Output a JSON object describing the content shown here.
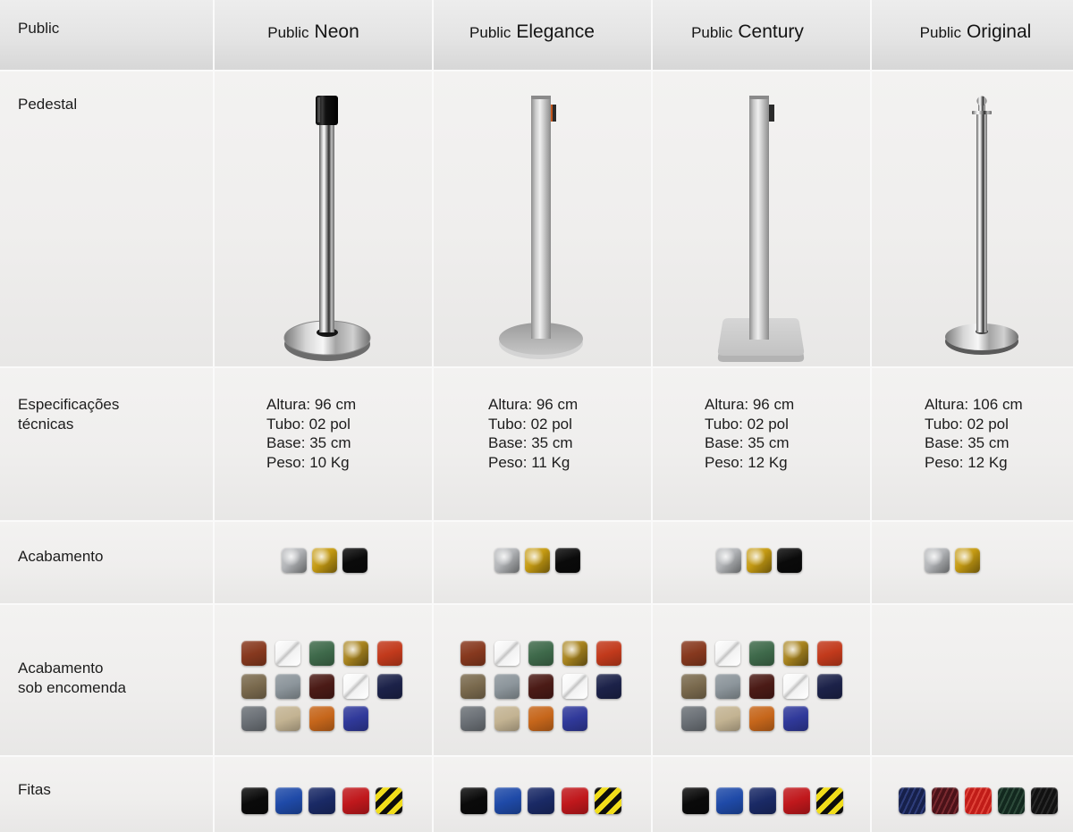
{
  "header": {
    "label": "Public",
    "products": [
      {
        "prefix": "Public",
        "name": "Neon"
      },
      {
        "prefix": "Public",
        "name": "Elegance"
      },
      {
        "prefix": "Public",
        "name": "Century"
      },
      {
        "prefix": "Public",
        "name": "Original"
      }
    ]
  },
  "pedestal": {
    "label": "Pedestal"
  },
  "specs": {
    "label_lines": [
      "Especificações",
      "técnicas"
    ],
    "products": [
      [
        "Altura: 96 cm",
        "Tubo: 02 pol",
        "Base: 35 cm",
        "Peso: 10 Kg"
      ],
      [
        "Altura: 96 cm",
        "Tubo: 02 pol",
        "Base: 35 cm",
        "Peso: 11 Kg"
      ],
      [
        "Altura: 96 cm",
        "Tubo: 02 pol",
        "Base: 35 cm",
        "Peso: 12 Kg"
      ],
      [
        "Altura: 106 cm",
        "Tubo: 02 pol",
        "Base: 35 cm",
        "Peso: 12 Kg"
      ]
    ]
  },
  "finish": {
    "label": "Acabamento",
    "products": [
      [
        {
          "finish": "metallic",
          "color": "#b3b5b8"
        },
        {
          "finish": "metallic",
          "color": "#c49a12"
        },
        {
          "finish": "solid",
          "color": "#0a0a0a"
        }
      ],
      [
        {
          "finish": "metallic",
          "color": "#b3b5b8"
        },
        {
          "finish": "metallic",
          "color": "#c49a12"
        },
        {
          "finish": "solid",
          "color": "#0a0a0a"
        }
      ],
      [
        {
          "finish": "metallic",
          "color": "#b3b5b8"
        },
        {
          "finish": "metallic",
          "color": "#c49a12"
        },
        {
          "finish": "solid",
          "color": "#0a0a0a"
        }
      ],
      [
        {
          "finish": "metallic",
          "color": "#b3b5b8"
        },
        {
          "finish": "metallic",
          "color": "#c49a12"
        }
      ]
    ]
  },
  "custom_finish": {
    "label_lines": [
      "Acabamento",
      "sob encomenda"
    ],
    "products": [
      [
        {
          "finish": "solid",
          "color": "#87391f"
        },
        {
          "finish": "pearl",
          "color": "#f4f4f4"
        },
        {
          "finish": "solid",
          "color": "#3f6a4b"
        },
        {
          "finish": "metallic",
          "color": "#a8841f"
        },
        {
          "finish": "solid",
          "color": "#c23a1c"
        },
        {
          "finish": "solid",
          "color": "#7a6a4e"
        },
        {
          "finish": "solid",
          "color": "#8c959b"
        },
        {
          "finish": "solid",
          "color": "#4b1b16"
        },
        {
          "finish": "pearl",
          "color": "#f7f7f7"
        },
        {
          "finish": "solid",
          "color": "#1c2249"
        },
        {
          "finish": "solid",
          "color": "#6c7177"
        },
        {
          "finish": "solid",
          "color": "#c3b392"
        },
        {
          "finish": "solid",
          "color": "#c6661b"
        },
        {
          "finish": "solid",
          "color": "#30399a"
        }
      ],
      [
        {
          "finish": "solid",
          "color": "#87391f"
        },
        {
          "finish": "pearl",
          "color": "#f4f4f4"
        },
        {
          "finish": "solid",
          "color": "#3f6a4b"
        },
        {
          "finish": "metallic",
          "color": "#a8841f"
        },
        {
          "finish": "solid",
          "color": "#c23a1c"
        },
        {
          "finish": "solid",
          "color": "#7a6a4e"
        },
        {
          "finish": "solid",
          "color": "#8c959b"
        },
        {
          "finish": "solid",
          "color": "#4b1b16"
        },
        {
          "finish": "pearl",
          "color": "#f7f7f7"
        },
        {
          "finish": "solid",
          "color": "#1c2249"
        },
        {
          "finish": "solid",
          "color": "#6c7177"
        },
        {
          "finish": "solid",
          "color": "#c3b392"
        },
        {
          "finish": "solid",
          "color": "#c6661b"
        },
        {
          "finish": "solid",
          "color": "#30399a"
        }
      ],
      [
        {
          "finish": "solid",
          "color": "#87391f"
        },
        {
          "finish": "pearl",
          "color": "#f4f4f4"
        },
        {
          "finish": "solid",
          "color": "#3f6a4b"
        },
        {
          "finish": "metallic",
          "color": "#a8841f"
        },
        {
          "finish": "solid",
          "color": "#c23a1c"
        },
        {
          "finish": "solid",
          "color": "#7a6a4e"
        },
        {
          "finish": "solid",
          "color": "#8c959b"
        },
        {
          "finish": "solid",
          "color": "#4b1b16"
        },
        {
          "finish": "pearl",
          "color": "#f7f7f7"
        },
        {
          "finish": "solid",
          "color": "#1c2249"
        },
        {
          "finish": "solid",
          "color": "#6c7177"
        },
        {
          "finish": "solid",
          "color": "#c3b392"
        },
        {
          "finish": "solid",
          "color": "#c6661b"
        },
        {
          "finish": "solid",
          "color": "#30399a"
        }
      ],
      []
    ]
  },
  "ribbons": {
    "label": "Fitas",
    "products": [
      [
        {
          "finish": "solid",
          "color": "#0a0a0a"
        },
        {
          "finish": "solid",
          "color": "#1f4aa8"
        },
        {
          "finish": "solid",
          "color": "#1a2a66"
        },
        {
          "finish": "solid",
          "color": "#c0181c"
        },
        {
          "finish": "hazard",
          "color": "#f1dd1a",
          "accent": "#0d0d0d"
        }
      ],
      [
        {
          "finish": "solid",
          "color": "#0a0a0a"
        },
        {
          "finish": "solid",
          "color": "#1f4aa8"
        },
        {
          "finish": "solid",
          "color": "#1a2a66"
        },
        {
          "finish": "solid",
          "color": "#c0181c"
        },
        {
          "finish": "hazard",
          "color": "#f1dd1a",
          "accent": "#0d0d0d"
        }
      ],
      [
        {
          "finish": "solid",
          "color": "#0a0a0a"
        },
        {
          "finish": "solid",
          "color": "#1f4aa8"
        },
        {
          "finish": "solid",
          "color": "#1a2a66"
        },
        {
          "finish": "solid",
          "color": "#c0181c"
        },
        {
          "finish": "hazard",
          "color": "#f1dd1a",
          "accent": "#0d0d0d"
        }
      ],
      [
        {
          "finish": "woven",
          "color": "#16204a",
          "accent": "#2e3d7a"
        },
        {
          "finish": "woven",
          "color": "#4a1218",
          "accent": "#7a2a30"
        },
        {
          "finish": "woven",
          "color": "#c01c18",
          "accent": "#e0443a"
        },
        {
          "finish": "woven",
          "color": "#12281e",
          "accent": "#2d4a3a"
        },
        {
          "finish": "woven",
          "color": "#111111",
          "accent": "#2a2a2a"
        }
      ]
    ]
  }
}
